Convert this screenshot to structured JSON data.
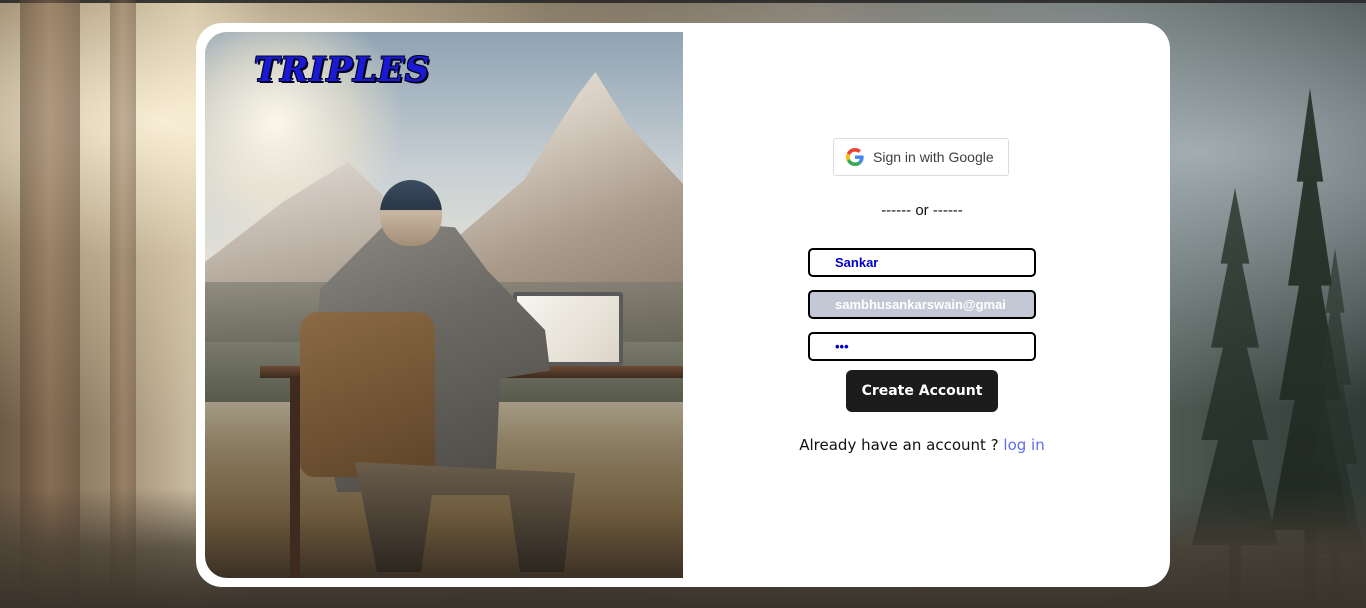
{
  "brand": {
    "name": "TRIPLES"
  },
  "google_signin": {
    "label": "Sign in with Google",
    "icon": "google-g-icon"
  },
  "divider": {
    "text": "------ or ------"
  },
  "form": {
    "username": {
      "value": "Sankar"
    },
    "email": {
      "value": "sambhusankarswain@gmai"
    },
    "password": {
      "value": "•••"
    },
    "submit_label": "Create Account"
  },
  "login_prompt": {
    "text": "Already have an account ?",
    "link_label": "log in"
  },
  "colors": {
    "brand_text": "#1a1ad6",
    "button_bg": "#1c1c1c",
    "link": "#5b6cf0",
    "field_text": "#0000cc",
    "autofill_bg": "#c3c8d4"
  }
}
